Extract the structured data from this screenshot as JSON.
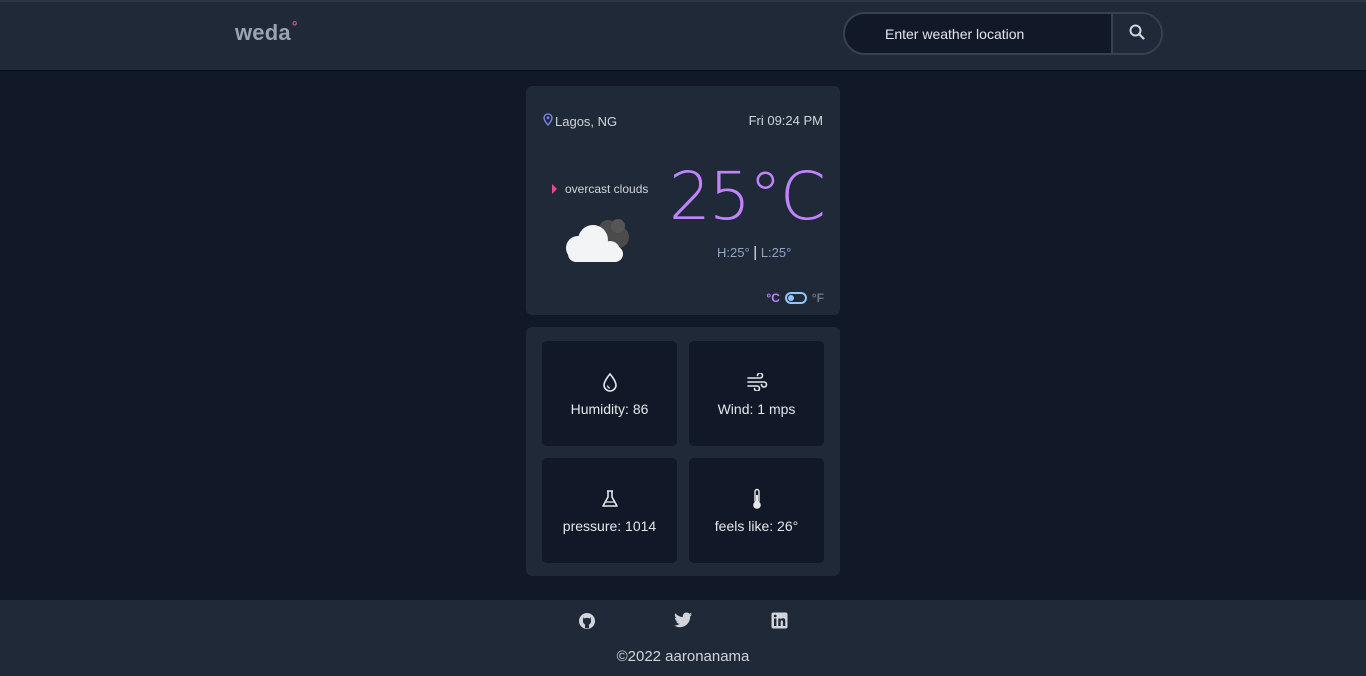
{
  "header": {
    "logo_text": "weda",
    "logo_mark": "°",
    "search": {
      "placeholder": "Enter weather location",
      "icon": "search-icon"
    }
  },
  "weather": {
    "location": "Lagos, NG",
    "datetime": "Fri 09:24 PM",
    "condition": "overcast clouds",
    "temperature": "25°C",
    "high": "H:25°",
    "separator": "|",
    "low": "L:25°",
    "unit_c": "°C",
    "unit_f": "°F",
    "selected_unit": "C"
  },
  "stats": [
    {
      "label": "Humidity: 86",
      "icon": "droplet-icon"
    },
    {
      "label": "Wind: 1 mps",
      "icon": "wind-icon"
    },
    {
      "label": "pressure: 1014",
      "icon": "flask-icon"
    },
    {
      "label": "feels like: 26°",
      "icon": "thermometer-icon"
    }
  ],
  "footer": {
    "links": [
      "github-icon",
      "twitter-icon",
      "linkedin-icon"
    ],
    "copyright": "©2022 aaronanama"
  },
  "colors": {
    "background": "#111827",
    "panel": "#1f2937",
    "accent_purple": "#c084fc",
    "accent_pink": "#ec4899"
  }
}
